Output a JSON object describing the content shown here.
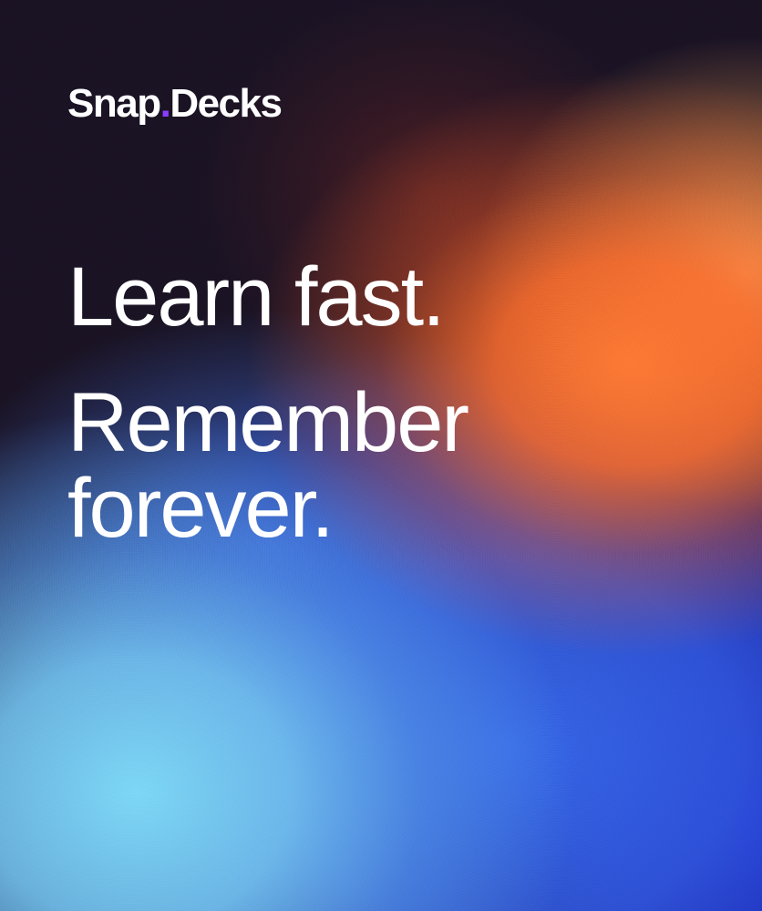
{
  "brand": {
    "name_part1": "Snap",
    "dot": ".",
    "name_part2": "Decks",
    "dot_color": "#8b3dff"
  },
  "headline": {
    "line1": "Learn fast.",
    "line2": "Remember",
    "line3": "forever."
  },
  "colors": {
    "background": "#1a1324",
    "orange": "#ff7a34",
    "light_blue": "#7dd7f5",
    "royal_blue": "#3769eb",
    "deep_blue": "#1419be",
    "text": "#ffffff"
  }
}
